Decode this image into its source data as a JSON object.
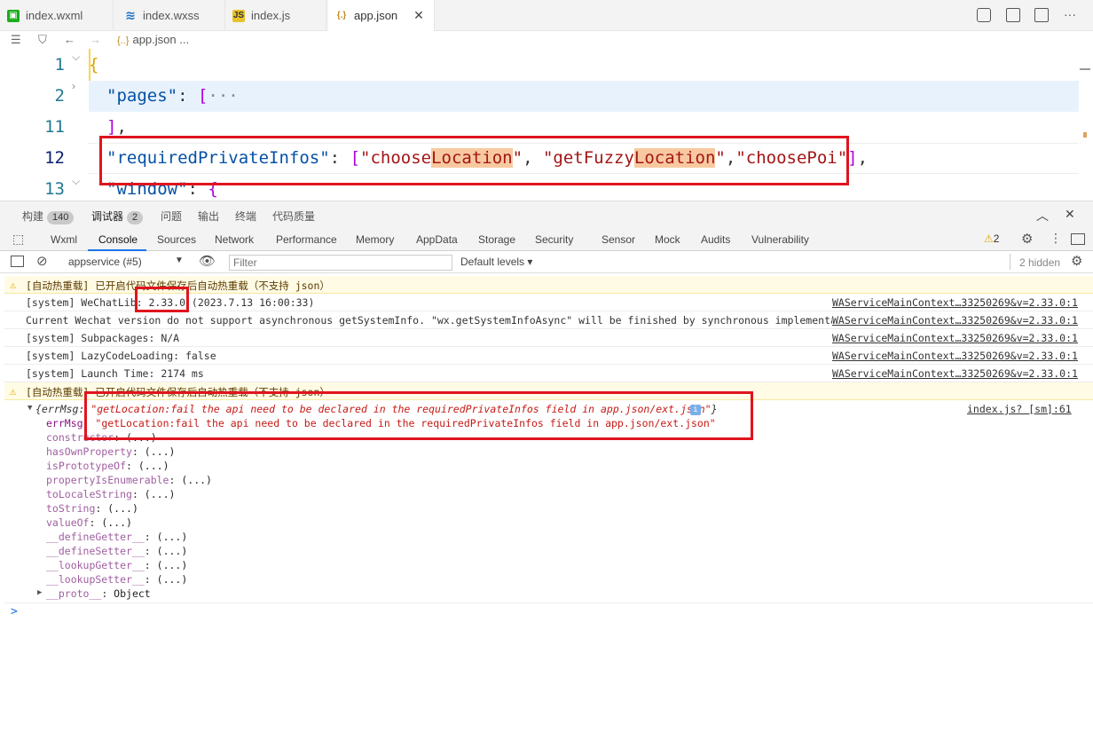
{
  "tabs": [
    {
      "label": "index.wxml",
      "icon": "wxml-file-icon"
    },
    {
      "label": "index.wxss",
      "icon": "wxss-file-icon"
    },
    {
      "label": "index.js",
      "icon": "js-file-icon"
    },
    {
      "label": "app.json",
      "icon": "json-file-icon",
      "active": true
    }
  ],
  "breadcrumb": {
    "icon_text": "{..}",
    "file": "app.json",
    "more": "..."
  },
  "editor": {
    "line_numbers": [
      "1",
      "2",
      "11",
      "12",
      "13"
    ],
    "line1": "{",
    "line2_key": "\"pages\"",
    "line2_colon": ": ",
    "line2_bracket": "[",
    "line2_ellipsis": "···",
    "line11": "],",
    "line12_key": "\"requiredPrivateInfos\"",
    "line12_colon": ": ",
    "line12_open": "[",
    "line12_s1a": "\"choose",
    "line12_s1b": "Location",
    "line12_s1c": "\"",
    "line12_sep1": ", ",
    "line12_s2a": "\"getFuzzy",
    "line12_s2b": "Location",
    "line12_s2c": "\"",
    "line12_sep2": ",",
    "line12_s3": "\"choosePoi\"",
    "line12_close": "]",
    "line12_end": ",",
    "line13_key": "\"window\"",
    "line13_colon": ": ",
    "line13_brace": "{"
  },
  "panel_tabs": [
    {
      "label": "构建",
      "badge": "140"
    },
    {
      "label": "调试器",
      "badge": "2"
    },
    {
      "label": "问题"
    },
    {
      "label": "输出"
    },
    {
      "label": "终端"
    },
    {
      "label": "代码质量"
    }
  ],
  "devtools_tabs": [
    "Wxml",
    "Console",
    "Sources",
    "Network",
    "Performance",
    "Memory",
    "AppData",
    "Storage",
    "Security",
    "Sensor",
    "Mock",
    "Audits",
    "Vulnerability"
  ],
  "warn_count": "2",
  "console_toolbar": {
    "context": "appservice (#5)",
    "filter_placeholder": "Filter",
    "levels": "Default levels",
    "hidden": "2 hidden"
  },
  "console_rows": [
    {
      "type": "warn",
      "text": "[自动热重载] 已开启代码文件保存后自动热重载（不支持 json）",
      "source": ""
    },
    {
      "type": "log",
      "text": "[system] WeChatLib: 2.33.0 (2023.7.13 16:00:33)",
      "source": "WAServiceMainContext…33250269&v=2.33.0:1"
    },
    {
      "type": "log",
      "text": "Current Wechat version do not support asynchronous getSystemInfo. \"wx.getSystemInfoAsync\" will be finished by synchronous implementation.",
      "source": "WAServiceMainContext…33250269&v=2.33.0:1"
    },
    {
      "type": "log",
      "text": "[system] Subpackages: N/A",
      "source": "WAServiceMainContext…33250269&v=2.33.0:1"
    },
    {
      "type": "log",
      "text": "[system] LazyCodeLoading: false",
      "source": "WAServiceMainContext…33250269&v=2.33.0:1"
    },
    {
      "type": "log",
      "text": "[system] Launch Time: 2174 ms",
      "source": "WAServiceMainContext…33250269&v=2.33.0:1"
    },
    {
      "type": "warn",
      "text": "[自动热重载] 已开启代码文件保存后自动热重载（不支持 json）",
      "source": ""
    }
  ],
  "error_object": {
    "summary_prefix": "{errMsg: ",
    "summary_msg": "\"getLocation:fail the api need to be declared in the requiredPrivateInfos field in app.json/ext.json\"",
    "summary_suffix": "}",
    "info_badge": "i",
    "source": "index.js? [sm]:61",
    "errmsg_key": "errMsg",
    "errmsg_val": "\"getLocation:fail the api need to be declared in the requiredPrivateInfos field in app.json/ext.json\"",
    "props": [
      "constructor",
      "hasOwnProperty",
      "isPrototypeOf",
      "propertyIsEnumerable",
      "toLocaleString",
      "toString",
      "valueOf",
      "__defineGetter__",
      "__defineSetter__",
      "__lookupGetter__",
      "__lookupSetter__"
    ],
    "prop_value": "(...)",
    "proto_key": "__proto__",
    "proto_val": "Object"
  },
  "prompt_symbol": ">"
}
